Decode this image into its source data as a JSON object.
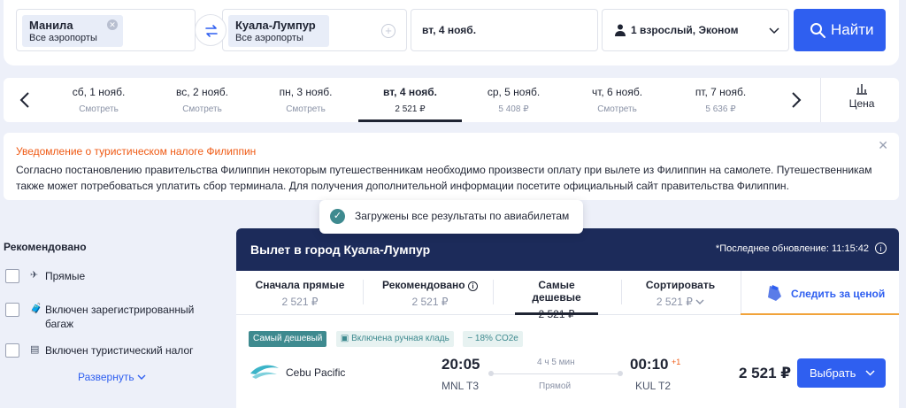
{
  "search": {
    "from": {
      "city": "Манила",
      "sub": "Все аэропорты"
    },
    "to": {
      "city": "Куала-Лумпур",
      "sub": "Все аэропорты"
    },
    "date": "вт, 4 нояб.",
    "passengers": "1 взрослый, Эконом",
    "search_label": "Найти"
  },
  "dates": [
    {
      "day": "сб, 1 нояб.",
      "price": "Смотреть"
    },
    {
      "day": "вс, 2 нояб.",
      "price": "Смотреть"
    },
    {
      "day": "пн, 3 нояб.",
      "price": "Смотреть"
    },
    {
      "day": "вт, 4 нояб.",
      "price": "2 521 ₽"
    },
    {
      "day": "ср, 5 нояб.",
      "price": "5 408 ₽"
    },
    {
      "day": "чт, 6 нояб.",
      "price": "Смотреть"
    },
    {
      "day": "пт, 7 нояб.",
      "price": "5 636 ₽"
    }
  ],
  "price_tab": "Цена",
  "notice": {
    "title": "Уведомление о туристическом налоге Филиппин",
    "body": "Согласно постановлению правительства Филиппин некоторым путешественникам необходимо произвести оплату при вылете из Филиппин на самолете. Путешественникам также может потребоваться уплатить сбор терминала. Для получения дополнительной информации посетите официальный сайт правительства Филиппин."
  },
  "toast": "Загружены все результаты по авиабилетам",
  "filters": {
    "heading": "Рекомендовано",
    "items": [
      "Прямые",
      "Включен зарегистрированный багаж",
      "Включен туристический налог"
    ],
    "expand": "Развернуть"
  },
  "results": {
    "title": "Вылет в город Куала-Лумпур",
    "updated": "*Последнее обновление: 11:15:42",
    "sorts": [
      {
        "label": "Сначала прямые",
        "price": "2 521 ₽"
      },
      {
        "label": "Рекомендовано",
        "price": "2 521 ₽"
      },
      {
        "label": "Самые дешевые",
        "price": "2 521 ₽"
      },
      {
        "label": "Сортировать",
        "price": "2 521 ₽"
      }
    ],
    "watch": "Следить за ценой",
    "tags": [
      "Самый дешевый",
      "Включена ручная кладь",
      "− 18% CO2e"
    ],
    "flight": {
      "airline": "Cebu Pacific",
      "dep_time": "20:05",
      "dep_airport": "MNL T3",
      "duration": "4 ч 5 мин",
      "stops": "Прямой",
      "arr_time": "00:10",
      "next_day": "+1",
      "arr_airport": "KUL T2",
      "price": "2 521 ₽",
      "choose": "Выбрать"
    }
  },
  "colors": {
    "accent": "#2f5ff0",
    "header": "#1c2b5a",
    "notice": "#ef5a14",
    "teal": "#3e8a8f"
  }
}
